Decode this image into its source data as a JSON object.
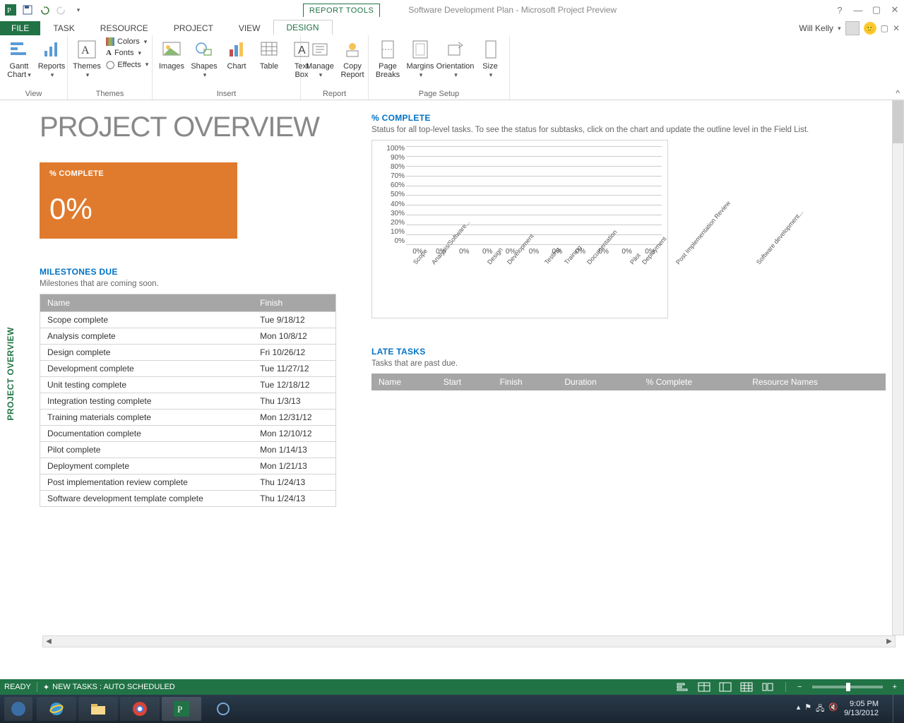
{
  "app_title": "Software Development Plan - Microsoft Project Preview",
  "contextual_tab": "REPORT TOOLS",
  "tabs": {
    "file": "FILE",
    "task": "TASK",
    "resource": "RESOURCE",
    "project": "PROJECT",
    "view": "VIEW",
    "design": "DESIGN"
  },
  "user": "Will Kelly",
  "ribbon": {
    "view_group": "View",
    "gantt": "Gantt\nChart",
    "reports": "Reports",
    "themes_group": "Themes",
    "themes": "Themes",
    "colors": "Colors",
    "fonts": "Fonts",
    "effects": "Effects",
    "insert_group": "Insert",
    "images": "Images",
    "shapes": "Shapes",
    "chart": "Chart",
    "table": "Table",
    "textbox": "Text\nBox",
    "report_group": "Report",
    "manage": "Manage",
    "copy_report": "Copy\nReport",
    "page_setup_group": "Page Setup",
    "page_breaks": "Page\nBreaks",
    "margins": "Margins",
    "orientation": "Orientation",
    "size": "Size"
  },
  "side_tab": "PROJECT OVERVIEW",
  "report_title": "PROJECT OVERVIEW",
  "complete_card": {
    "label": "% COMPLETE",
    "value": "0%"
  },
  "milestones": {
    "title": "MILESTONES DUE",
    "sub": "Milestones that are coming soon.",
    "cols": {
      "name": "Name",
      "finish": "Finish"
    },
    "rows": [
      {
        "name": "Scope complete",
        "finish": "Tue 9/18/12"
      },
      {
        "name": "Analysis complete",
        "finish": "Mon 10/8/12"
      },
      {
        "name": "Design complete",
        "finish": "Fri 10/26/12"
      },
      {
        "name": "Development complete",
        "finish": "Tue 11/27/12"
      },
      {
        "name": "Unit testing complete",
        "finish": "Tue 12/18/12"
      },
      {
        "name": "Integration testing complete",
        "finish": "Thu 1/3/13"
      },
      {
        "name": "Training materials complete",
        "finish": "Mon 12/31/12"
      },
      {
        "name": "Documentation complete",
        "finish": "Mon 12/10/12"
      },
      {
        "name": "Pilot complete",
        "finish": "Mon 1/14/13"
      },
      {
        "name": "Deployment complete",
        "finish": "Mon 1/21/13"
      },
      {
        "name": "Post implementation review complete",
        "finish": "Thu 1/24/13"
      },
      {
        "name": "Software development template complete",
        "finish": "Thu 1/24/13"
      }
    ]
  },
  "pct_complete_chart": {
    "title": "% COMPLETE",
    "sub": "Status for all top-level tasks. To see the status for subtasks, click on the chart and update the outline level in the Field List."
  },
  "chart_data": {
    "type": "bar",
    "title": "% COMPLETE",
    "ylabel": "",
    "ylim": [
      0,
      100
    ],
    "y_ticks": [
      "100%",
      "90%",
      "80%",
      "70%",
      "60%",
      "50%",
      "40%",
      "30%",
      "20%",
      "10%",
      "0%"
    ],
    "categories": [
      "Scope",
      "Analysis/Software...",
      "Design",
      "Development",
      "Testing",
      "Training",
      "Documentation",
      "Pilot",
      "Deployment",
      "Post Implementation Review",
      "Software development..."
    ],
    "values": [
      0,
      0,
      0,
      0,
      0,
      0,
      0,
      0,
      0,
      0,
      0
    ],
    "data_labels": [
      "0%",
      "0%",
      "0%",
      "0%",
      "0%",
      "0%",
      "0%",
      "0%",
      "0%",
      "0%",
      "0%"
    ]
  },
  "late_tasks": {
    "title": "LATE TASKS",
    "sub": "Tasks that are past due.",
    "cols": {
      "name": "Name",
      "start": "Start",
      "finish": "Finish",
      "duration": "Duration",
      "pct": "% Complete",
      "res": "Resource Names"
    }
  },
  "status": {
    "ready": "READY",
    "newtasks": "NEW TASKS : AUTO SCHEDULED"
  },
  "clock": {
    "time": "9:05 PM",
    "date": "9/13/2012"
  }
}
